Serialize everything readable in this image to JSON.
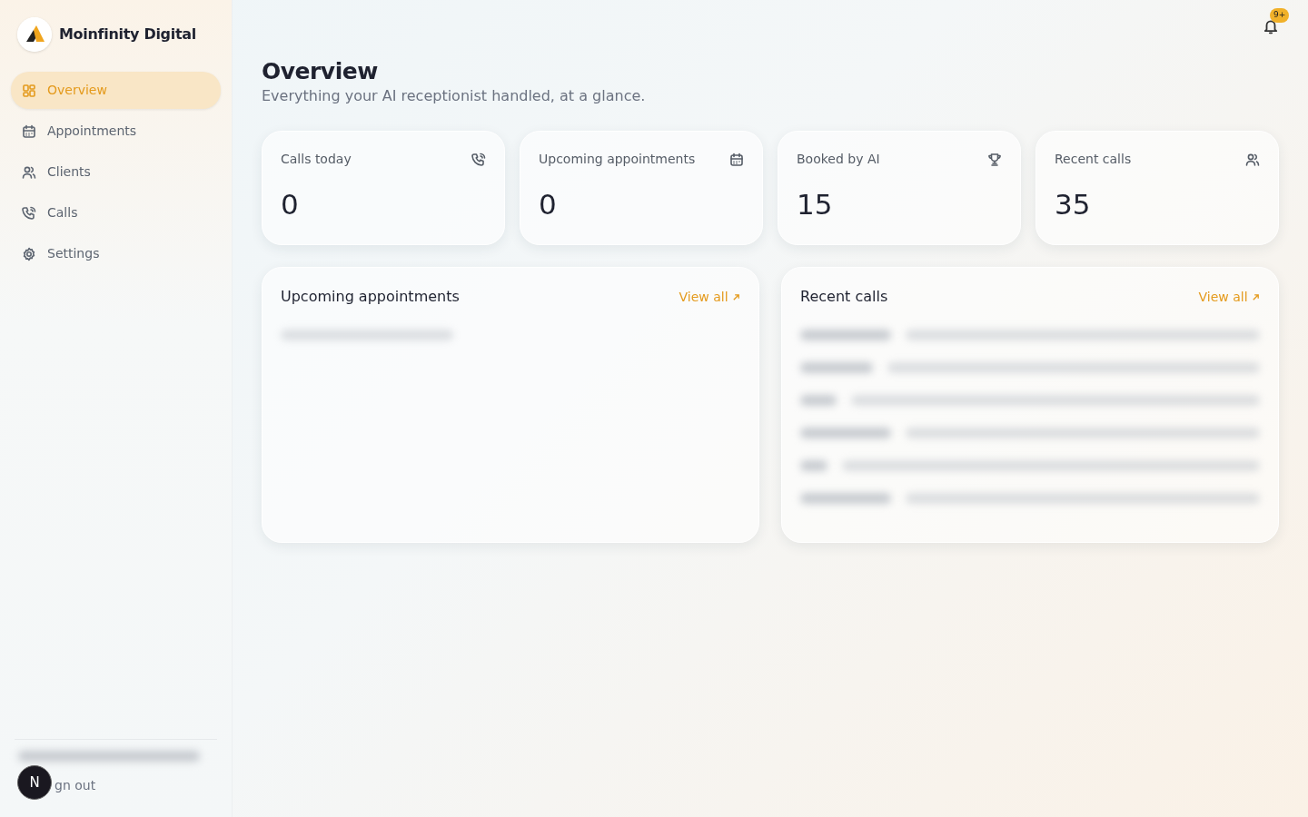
{
  "brand": {
    "name": "Moinfinity Digital"
  },
  "sidebar": {
    "items": [
      {
        "label": "Overview",
        "kind": "grid",
        "selected": true
      },
      {
        "label": "Appointments",
        "kind": "calendar",
        "selected": false
      },
      {
        "label": "Clients",
        "kind": "users",
        "selected": false
      },
      {
        "label": "Calls",
        "kind": "phone",
        "selected": false
      },
      {
        "label": "Settings",
        "kind": "gear",
        "selected": false
      }
    ],
    "sign_out": "gn out",
    "dev_badge": "N"
  },
  "header": {
    "notification_count": "9+"
  },
  "page": {
    "title": "Overview",
    "subtitle": "Everything your AI receptionist handled, at a glance."
  },
  "stats": [
    {
      "label": "Calls today",
      "value": "0",
      "kind": "phone"
    },
    {
      "label": "Upcoming appointments",
      "value": "0",
      "kind": "calendar"
    },
    {
      "label": "Booked by AI",
      "value": "15",
      "kind": "trophy"
    },
    {
      "label": "Recent calls",
      "value": "35",
      "kind": "users"
    }
  ],
  "panels": [
    {
      "title": "Upcoming appointments",
      "link": "View all",
      "kind": "empty"
    },
    {
      "title": "Recent calls",
      "link": "View all",
      "kind": "list"
    }
  ]
}
